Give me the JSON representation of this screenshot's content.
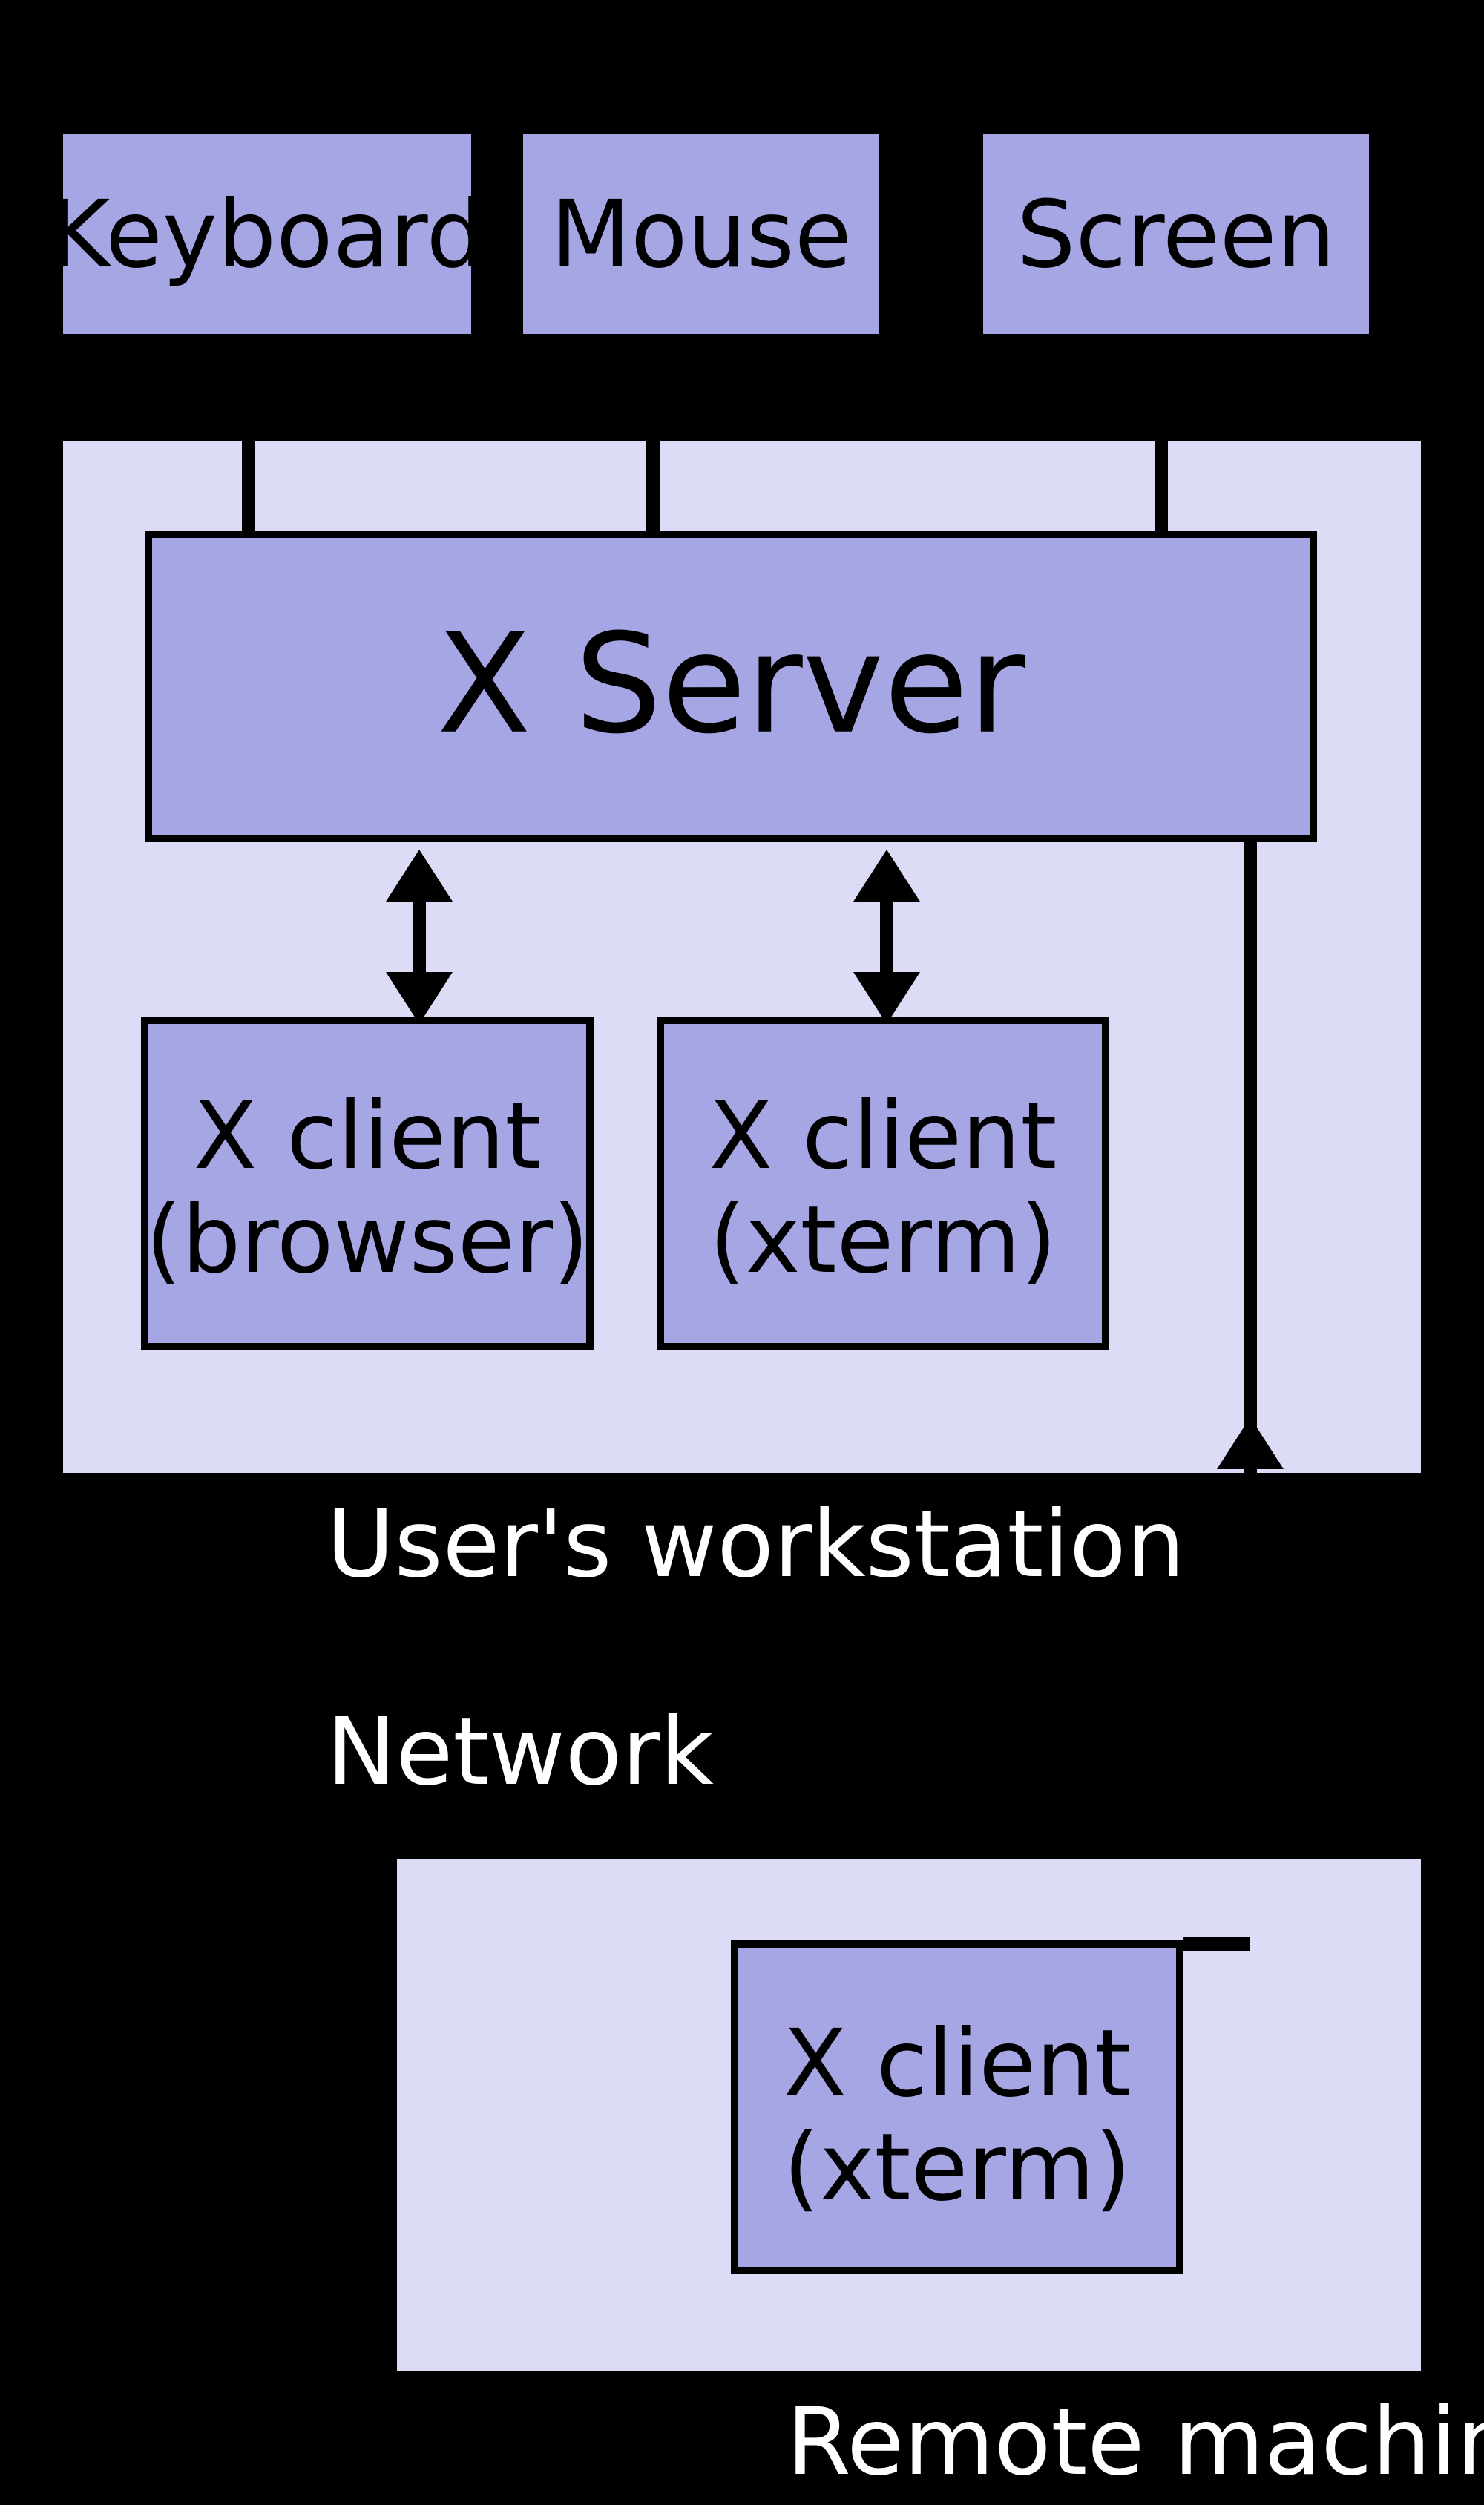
{
  "top": {
    "keyboard": "Keyboard",
    "mouse": "Mouse",
    "screen": "Screen"
  },
  "host1": {
    "label": "User's workstation",
    "server": "X Server",
    "client1_line1": "X client",
    "client1_line2": "(browser)",
    "client2_line1": "X client",
    "client2_line2": "(xterm)"
  },
  "network": "Network",
  "host2": {
    "label": "Remote machine",
    "client_line1": "X client",
    "client_line2": "(xterm)"
  }
}
